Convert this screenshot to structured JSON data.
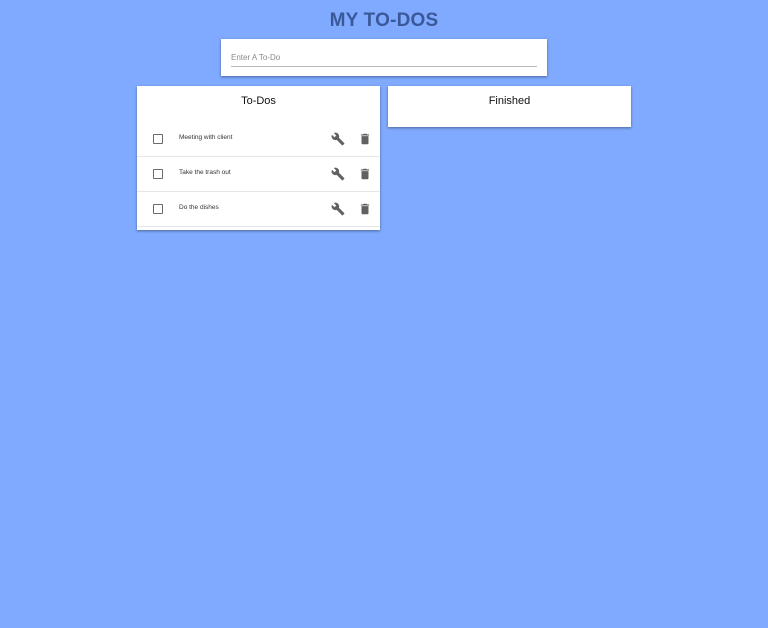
{
  "header": {
    "title": "MY TO-DOS"
  },
  "input": {
    "placeholder": "Enter A To-Do",
    "value": ""
  },
  "todos": {
    "title": "To-Dos",
    "items": [
      {
        "text": "Meeting with client",
        "done": false
      },
      {
        "text": "Take the trash out",
        "done": false
      },
      {
        "text": "Do the dishes",
        "done": false
      }
    ]
  },
  "finished": {
    "title": "Finished",
    "items": []
  },
  "icons": {
    "edit": "wrench-icon",
    "delete": "trash-icon",
    "checkbox": "checkbox-unchecked-icon"
  },
  "colors": {
    "background": "#80aaff",
    "title": "#3b5998",
    "icon": "#616161"
  }
}
